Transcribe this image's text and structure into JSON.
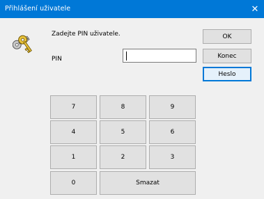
{
  "window": {
    "title": "Přihlášení uživatele",
    "close_glyph": "✕"
  },
  "icon": "keys-icon",
  "prompt": "Zadejte PIN uživatele.",
  "pin": {
    "label": "PIN",
    "value": ""
  },
  "side_buttons": {
    "ok": "OK",
    "konec": "Konec",
    "heslo": "Heslo"
  },
  "keypad": {
    "k7": "7",
    "k8": "8",
    "k9": "9",
    "k4": "4",
    "k5": "5",
    "k6": "6",
    "k1": "1",
    "k2": "2",
    "k3": "3",
    "k0": "0",
    "clear": "Smazat"
  },
  "colors": {
    "title_bar": "#0078d7",
    "client_bg": "#f0f0f0",
    "button_bg": "#e1e1e1"
  }
}
